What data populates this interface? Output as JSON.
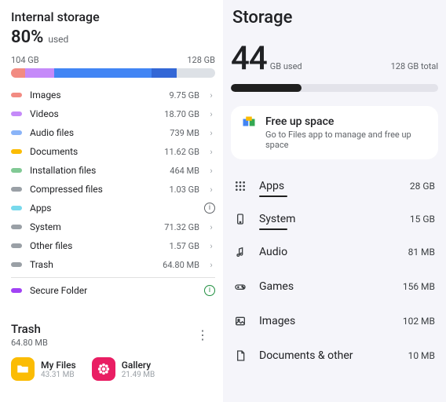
{
  "left": {
    "title": "Internal storage",
    "percent": "80%",
    "percentLabel": "used",
    "used": "104 GB",
    "capacity": "128 GB",
    "segments": [
      {
        "color": "#f28b82",
        "w": "7"
      },
      {
        "color": "#c58af9",
        "w": "14"
      },
      {
        "color": "#4285f4",
        "w": "48"
      },
      {
        "color": "#3367d6",
        "w": "12"
      },
      {
        "color": "#dde1e6",
        "w": "19"
      }
    ],
    "categories": [
      {
        "label": "Images",
        "size": "9.75 GB",
        "color": "#f28b82"
      },
      {
        "label": "Videos",
        "size": "18.70 GB",
        "color": "#c58af9"
      },
      {
        "label": "Audio files",
        "size": "739 MB",
        "color": "#8ab4f8"
      },
      {
        "label": "Documents",
        "size": "11.62 GB",
        "color": "#fbbc04"
      },
      {
        "label": "Installation files",
        "size": "464 MB",
        "color": "#81c995"
      },
      {
        "label": "Compressed files",
        "size": "1.03 GB",
        "color": "#9aa0a6"
      },
      {
        "label": "Apps",
        "size": "",
        "color": "#78d9ec",
        "info": "dark"
      },
      {
        "label": "System",
        "size": "71.32 GB",
        "color": "#9aa0a6"
      },
      {
        "label": "Other files",
        "size": "1.57 GB",
        "color": "#9aa0a6"
      },
      {
        "label": "Trash",
        "size": "64.80 MB",
        "color": "#9aa0a6"
      }
    ],
    "secure": {
      "label": "Secure Folder",
      "color": "#a142f4",
      "info": "green"
    },
    "trash": {
      "title": "Trash",
      "size": "64.80 MB"
    },
    "trashApps": [
      {
        "name": "My Files",
        "size": "43.31 MB",
        "icon": "folder",
        "bg": "#fbbc04"
      },
      {
        "name": "Gallery",
        "size": "21.49 MB",
        "icon": "flower",
        "bg": "#e91e63"
      }
    ]
  },
  "right": {
    "title": "Storage",
    "big": "44",
    "bigLabel": "GB used",
    "total": "128 GB total",
    "fillPct": 34,
    "free": {
      "title": "Free up space",
      "sub": "Go to Files app to manage and free up space"
    },
    "cats": [
      {
        "label": "Apps",
        "size": "28 GB",
        "icon": "grid",
        "underline": true
      },
      {
        "label": "System",
        "size": "15 GB",
        "icon": "phone",
        "underline": true
      },
      {
        "label": "Audio",
        "size": "81 MB",
        "icon": "note"
      },
      {
        "label": "Games",
        "size": "156 MB",
        "icon": "game"
      },
      {
        "label": "Images",
        "size": "102 MB",
        "icon": "image"
      },
      {
        "label": "Documents & other",
        "size": "10 MB",
        "icon": "doc"
      }
    ]
  }
}
